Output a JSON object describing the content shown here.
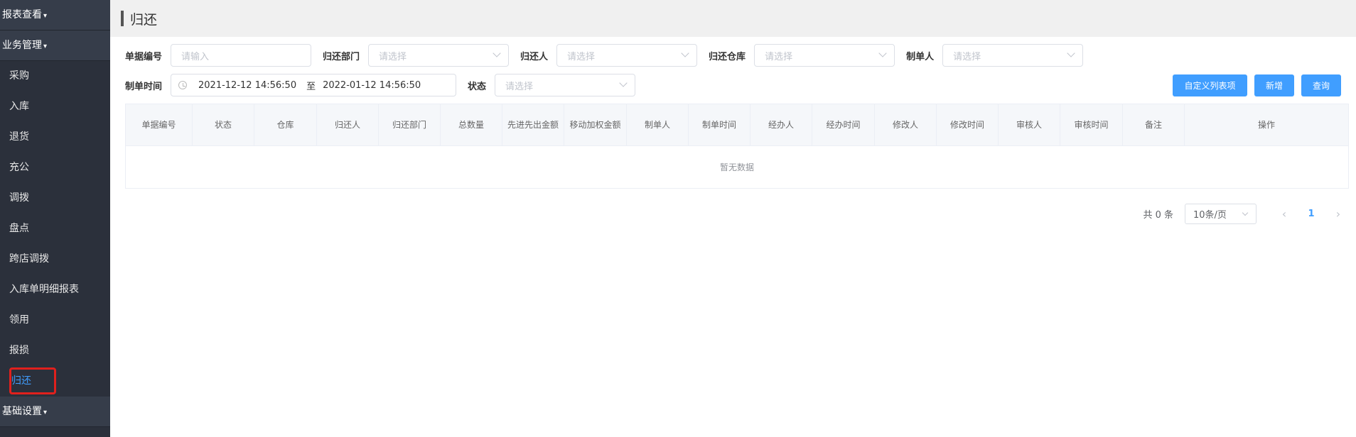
{
  "sidebar": {
    "groups": [
      {
        "label": "报表查看"
      },
      {
        "label": "业务管理"
      },
      {
        "label": "基础设置"
      }
    ],
    "items": [
      {
        "label": "采购"
      },
      {
        "label": "入库"
      },
      {
        "label": "退货"
      },
      {
        "label": "充公"
      },
      {
        "label": "调拨"
      },
      {
        "label": "盘点"
      },
      {
        "label": "跨店调拨"
      },
      {
        "label": "入库单明细报表"
      },
      {
        "label": "领用"
      },
      {
        "label": "报损"
      },
      {
        "label": "归还"
      }
    ],
    "caret": "▾"
  },
  "header": {
    "title": "归还"
  },
  "filters": {
    "doc_no": {
      "label": "单据编号",
      "placeholder": "请输入"
    },
    "dept": {
      "label": "归还部门",
      "placeholder": "请选择"
    },
    "returner": {
      "label": "归还人",
      "placeholder": "请选择"
    },
    "warehouse": {
      "label": "归还仓库",
      "placeholder": "请选择"
    },
    "creator": {
      "label": "制单人",
      "placeholder": "请选择"
    },
    "create_time": {
      "label": "制单时间",
      "start": "2021-12-12 14:56:50",
      "separator": "至",
      "end": "2022-01-12 14:56:50"
    },
    "status": {
      "label": "状态",
      "placeholder": "请选择"
    }
  },
  "buttons": {
    "custom_columns": "自定义列表项",
    "add": "新增",
    "search": "查询"
  },
  "table": {
    "columns": [
      "单据编号",
      "状态",
      "仓库",
      "归还人",
      "归还部门",
      "总数量",
      "先进先出金额",
      "移动加权金额",
      "制单人",
      "制单时间",
      "经办人",
      "经办时间",
      "修改人",
      "修改时间",
      "审核人",
      "审核时间",
      "备注",
      "操作"
    ],
    "empty_text": "暂无数据"
  },
  "pagination": {
    "total": "共 0 条",
    "page_size": "10条/页",
    "current_page": "1",
    "prev": "‹",
    "next": "›"
  },
  "colors": {
    "accent": "#409eff",
    "sidebar_bg": "#2b303b",
    "highlight_border": "#e0201d"
  }
}
